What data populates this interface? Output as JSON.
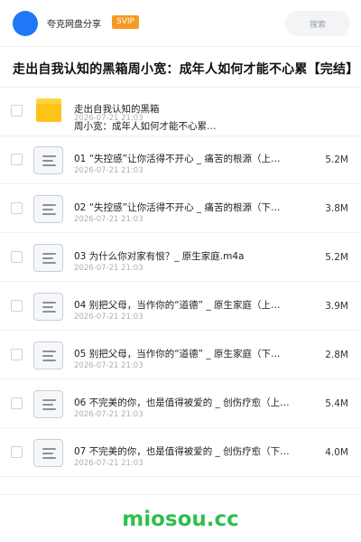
{
  "header": {
    "brand": "夸克网盘分享",
    "badge": "SVIP",
    "search_placeholder": "搜索"
  },
  "folder_title": "走出自我认知的黑箱周小宽：成年人如何才能不心累【完结】",
  "folder_row": {
    "name_line1": "走出自我认知的黑箱",
    "name_line2": "周小宽：成年人如何才能不心累…",
    "date": "2026-07-21 21:03"
  },
  "files": [
    {
      "name": "01 “失控感”让你活得不开心 _ 痛苦的根源（上…",
      "date": "2026-07-21 21:03",
      "size": "5.2M"
    },
    {
      "name": "02 “失控感”让你活得不开心 _ 痛苦的根源（下…",
      "date": "2026-07-21 21:03",
      "size": "3.8M"
    },
    {
      "name": "03 为什么你对家有恨？_ 原生家庭.m4a",
      "date": "2026-07-21 21:03",
      "size": "5.2M"
    },
    {
      "name": "04 别把父母，当作你的“道德” _ 原生家庭（上…",
      "date": "2026-07-21 21:03",
      "size": "3.9M"
    },
    {
      "name": "05 别把父母，当作你的“道德” _ 原生家庭（下…",
      "date": "2026-07-21 21:03",
      "size": "2.8M"
    },
    {
      "name": "06 不完美的你，也是值得被爱的 _ 创伤疗愈（上…",
      "date": "2026-07-21 21:03",
      "size": "5.4M"
    },
    {
      "name": "07 不完美的你，也是值得被爱的 _ 创伤疗愈（下…",
      "date": "2026-07-21 21:03",
      "size": "4.0M"
    }
  ],
  "watermark": "miosou.cc",
  "colors": {
    "accent": "#1f78f5",
    "svip": "#f59a23",
    "folder": "#fcc419",
    "watermark": "#2fbf4e"
  },
  "icons": {
    "avatar": "avatar-circle",
    "folder": "folder-icon",
    "file": "audio-file-icon"
  }
}
